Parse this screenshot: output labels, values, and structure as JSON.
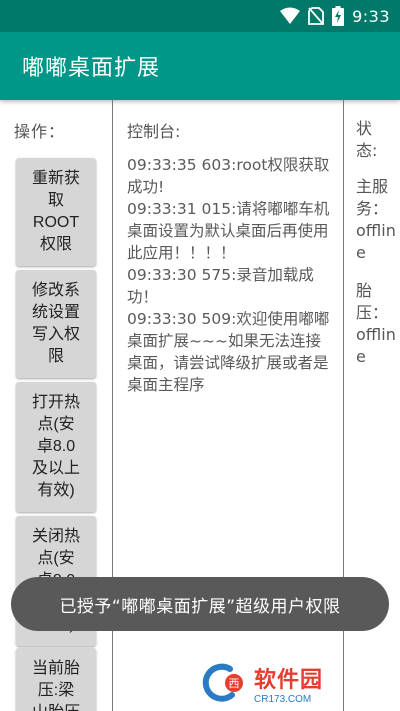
{
  "status_bar": {
    "time": "9:33",
    "icons": [
      "wifi-icon",
      "no-sim-icon",
      "battery-charging-icon"
    ]
  },
  "app_bar": {
    "title": "嘟嘟桌面扩展"
  },
  "operations": {
    "label": "操作：",
    "buttons": [
      "重新获\n取\nROOT\n权限",
      "修改系\n统设置\n写入权\n限",
      "打开热\n点(安\n卓8.0\n及以上\n有效)",
      "关闭热\n点(安\n卓8.0\n及以上\n有效)",
      "当前胎\n压:梁\n山胎压"
    ]
  },
  "console": {
    "label": "控制台:",
    "logs": [
      "09:33:35 603:root权限获取成功!",
      "09:33:31 015:请将嘟嘟车机桌面设置为默认桌面后再使用此应用！！！！",
      "09:33:30 575:录音加载成功！",
      "09:33:30 509:欢迎使用嘟嘟桌面扩展~~~如果无法连接桌面，请尝试降级扩展或者是桌面主程序"
    ]
  },
  "status": {
    "label": "状态:",
    "entries": [
      {
        "name": "主服务",
        "value": "offline"
      },
      {
        "name": "胎压",
        "value": "offline"
      }
    ]
  },
  "toast": {
    "message": "已授予“嘟嘟桌面扩展”超级用户权限"
  },
  "watermark": {
    "brand": "软件园",
    "url": "CR173.COM"
  },
  "colors": {
    "status_bar": "#00796B",
    "app_bar": "#009688",
    "button_bg": "#d6d6d6",
    "toast_bg": "#595959",
    "watermark_red": "#e63d2e",
    "watermark_blue": "#2b7bc4"
  }
}
